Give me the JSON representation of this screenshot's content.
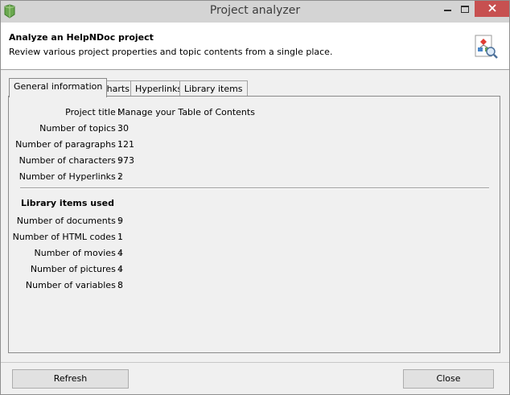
{
  "window": {
    "title": "Project analyzer"
  },
  "header": {
    "title": "Analyze an HelpNDoc project",
    "subtitle": "Review various project properties and topic contents from a single place."
  },
  "tabs": [
    {
      "label": "General information",
      "active": true
    },
    {
      "label": "Charts",
      "active": false
    },
    {
      "label": "Hyperlinks",
      "active": false
    },
    {
      "label": "Library items",
      "active": false
    }
  ],
  "general": {
    "rows": [
      {
        "label": "Project title :",
        "value": "Manage your Table of Contents"
      },
      {
        "label": "Number of topics :",
        "value": "30"
      },
      {
        "label": "Number of paragraphs :",
        "value": "121"
      },
      {
        "label": "Number of characters :",
        "value": "973"
      },
      {
        "label": "Number of Hyperlinks :",
        "value": "2"
      }
    ]
  },
  "library": {
    "title": "Library items used",
    "rows": [
      {
        "label": "Number of documents :",
        "value": "9"
      },
      {
        "label": "Number of HTML codes :",
        "value": "1"
      },
      {
        "label": "Number of movies :",
        "value": "4"
      },
      {
        "label": "Number of pictures :",
        "value": "4"
      },
      {
        "label": "Number of variables :",
        "value": "8"
      }
    ]
  },
  "buttons": {
    "refresh": "Refresh",
    "close": "Close"
  },
  "icons": {
    "app": "helpndoc-app-icon",
    "header": "project-analyzer-icon",
    "minimize": "minimize-icon",
    "maximize": "maximize-icon",
    "close": "close-icon"
  },
  "colors": {
    "titlebar": "#d4d4d4",
    "close_button": "#c75050",
    "header_bg": "#ffffff",
    "dialog_bg": "#f0f0f0"
  }
}
